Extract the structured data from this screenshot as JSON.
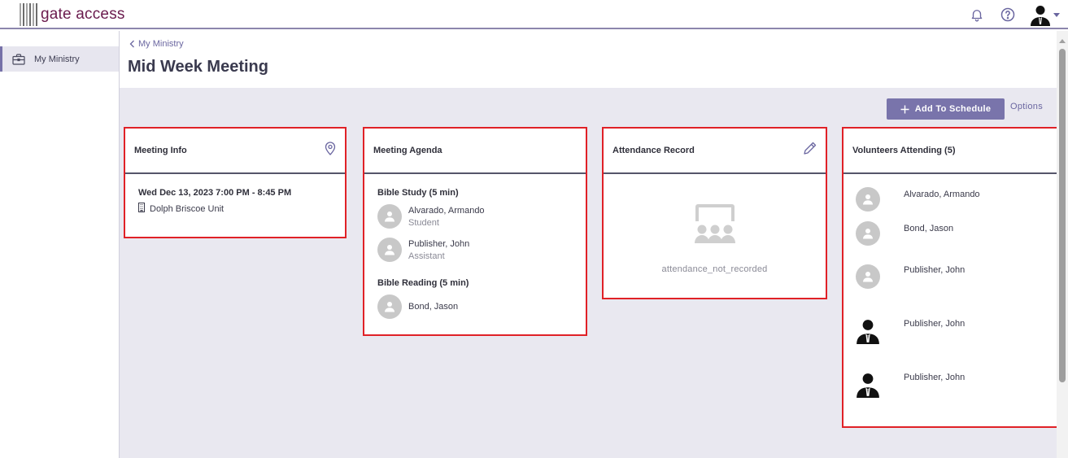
{
  "app": {
    "logo_text": "gate access"
  },
  "topbar": {
    "bell_icon": "bell-icon",
    "help_icon": "help-icon",
    "user_icon": "user-avatar-icon"
  },
  "sidebar": {
    "items": [
      {
        "label": "My Ministry",
        "icon": "briefcase-icon"
      }
    ]
  },
  "breadcrumb": {
    "back_label": "My Ministry"
  },
  "page": {
    "title": "Mid Week Meeting"
  },
  "toolbar": {
    "add_label": "Add To Schedule",
    "options_label": "Options"
  },
  "meeting_info": {
    "title": "Meeting Info",
    "datetime": "Wed Dec 13, 2023 7:00 PM - 8:45 PM",
    "location": "Dolph Briscoe Unit"
  },
  "agenda": {
    "title": "Meeting Agenda",
    "sections": [
      {
        "heading": "Bible Study (5 min)",
        "people": [
          {
            "name": "Alvarado, Armando",
            "role": "Student"
          },
          {
            "name": "Publisher, John",
            "role": "Assistant"
          }
        ]
      },
      {
        "heading": "Bible Reading (5 min)",
        "people": [
          {
            "name": "Bond, Jason",
            "role": ""
          }
        ]
      }
    ]
  },
  "attendance": {
    "title": "Attendance Record",
    "empty_text": "attendance_not_recorded"
  },
  "volunteers": {
    "title": "Volunteers Attending (5)",
    "people": [
      {
        "name": "Alvarado, Armando",
        "avatar": "placeholder"
      },
      {
        "name": "Bond, Jason",
        "avatar": "placeholder"
      },
      {
        "name": "Publisher, John",
        "avatar": "placeholder"
      },
      {
        "name": "Publisher, John",
        "avatar": "photo"
      },
      {
        "name": "Publisher, John",
        "avatar": "photo"
      }
    ]
  },
  "colors": {
    "accent": "#7974ab",
    "highlight": "#e02127",
    "logo": "#6a1a4d",
    "content_bg": "#e9e8f0"
  }
}
